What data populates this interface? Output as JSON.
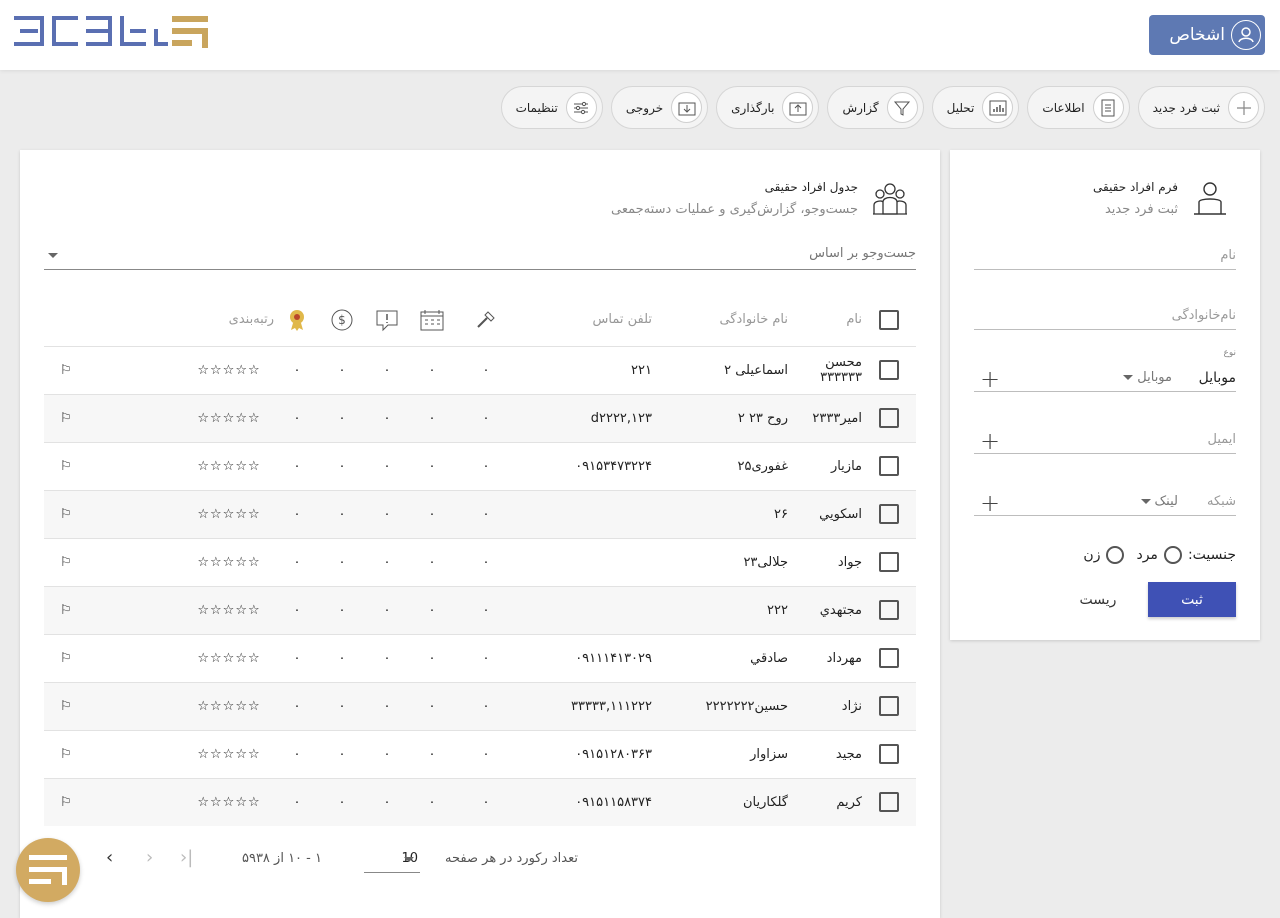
{
  "header": {
    "page_title": "اشخاص",
    "toolbar": [
      {
        "label": "ثبت فرد جدید",
        "icon": "plus-icon"
      },
      {
        "label": "اطلاعات",
        "icon": "document-icon"
      },
      {
        "label": "تحلیل",
        "icon": "bar-chart-icon"
      },
      {
        "label": "گزارش",
        "icon": "filter-icon"
      },
      {
        "label": "بارگذاری",
        "icon": "upload-icon"
      },
      {
        "label": "خروجی",
        "icon": "download-icon"
      },
      {
        "label": "تنظیمات",
        "icon": "sliders-icon"
      }
    ]
  },
  "form": {
    "title": "فرم افراد حقیقی",
    "subtitle": "ثبت فرد جدید",
    "name_placeholder": "نام",
    "family_placeholder": "نام‌خانوادگی",
    "type_label": "نوع",
    "type_value": "موبایل",
    "type_sub": "موبایل",
    "email_placeholder": "ایمیل",
    "network_placeholder": "شبکه",
    "network_sub": "لینک",
    "gender_label": "جنسیت:",
    "gender_options": [
      "مرد",
      "زن"
    ],
    "submit_label": "ثبت",
    "reset_label": "ریست"
  },
  "table": {
    "title": "جدول افراد حقیقی",
    "subtitle": "جست‌وجو، گزارش‌گیری و عملیات دسته‌جمعی",
    "search_placeholder": "جست‌وجو بر اساس",
    "columns": {
      "name": "نام",
      "family": "نام خانوادگی",
      "phone": "تلفن تماس",
      "rating": "رتبه‌بندی"
    },
    "rows": [
      {
        "name": "محسن ۳۳۳۳۳۳",
        "family": "اسماعیلی ۲",
        "phone": "۲۲۱",
        "c1": "۰",
        "c2": "۰",
        "c3": "۰",
        "c4": "۰",
        "c5": "۰",
        "stars": "☆☆☆☆☆"
      },
      {
        "name": "امیر۲۳۳۳",
        "family": "روح ۲۳ ۲",
        "phone": "d۲۲۲۲,۱۲۳",
        "c1": "۰",
        "c2": "۰",
        "c3": "۰",
        "c4": "۰",
        "c5": "۰",
        "stars": "☆☆☆☆☆"
      },
      {
        "name": "مازیار",
        "family": "غفوری۲۵",
        "phone": "۰۹۱۵۳۴۷۳۲۲۴",
        "c1": "۰",
        "c2": "۰",
        "c3": "۰",
        "c4": "۰",
        "c5": "۰",
        "stars": "☆☆☆☆☆"
      },
      {
        "name": "اسكويي",
        "family": "۲۶",
        "phone": "",
        "c1": "۰",
        "c2": "۰",
        "c3": "۰",
        "c4": "۰",
        "c5": "۰",
        "stars": "☆☆☆☆☆"
      },
      {
        "name": "جواد",
        "family": "جلالی۲۳",
        "phone": "",
        "c1": "۰",
        "c2": "۰",
        "c3": "۰",
        "c4": "۰",
        "c5": "۰",
        "stars": "☆☆☆☆☆"
      },
      {
        "name": "مجتهدي",
        "family": "۲۲۲",
        "phone": "",
        "c1": "۰",
        "c2": "۰",
        "c3": "۰",
        "c4": "۰",
        "c5": "۰",
        "stars": "☆☆☆☆☆"
      },
      {
        "name": "مهرداد",
        "family": "صادقي",
        "phone": "۰۹۱۱۱۴۱۳۰۲۹",
        "c1": "۰",
        "c2": "۰",
        "c3": "۰",
        "c4": "۰",
        "c5": "۰",
        "stars": "☆☆☆☆☆"
      },
      {
        "name": "نژاد",
        "family": "حسین۲۲۲۲۲۲۲",
        "phone": "۳۳۳۳۳,۱۱۱۲۲۲",
        "c1": "۰",
        "c2": "۰",
        "c3": "۰",
        "c4": "۰",
        "c5": "۰",
        "stars": "☆☆☆☆☆"
      },
      {
        "name": "مجید",
        "family": "سزاوار",
        "phone": "۰۹۱۵۱۲۸۰۳۶۳",
        "c1": "۰",
        "c2": "۰",
        "c3": "۰",
        "c4": "۰",
        "c5": "۰",
        "stars": "☆☆☆☆☆"
      },
      {
        "name": "کریم",
        "family": "گلکاریان",
        "phone": "۰۹۱۵۱۱۵۸۳۷۴",
        "c1": "۰",
        "c2": "۰",
        "c3": "۰",
        "c4": "۰",
        "c5": "۰",
        "stars": "☆☆☆☆☆"
      }
    ],
    "pagination": {
      "per_page_label": "تعداد رکورد در هر صفحه",
      "per_page_value": "10",
      "range": "۱ - ۱۰ از ۵۹۳۸"
    }
  },
  "colors": {
    "brand_blue": "#5e79b3",
    "submit": "#3f51b5",
    "gold": "#d2aa62"
  }
}
